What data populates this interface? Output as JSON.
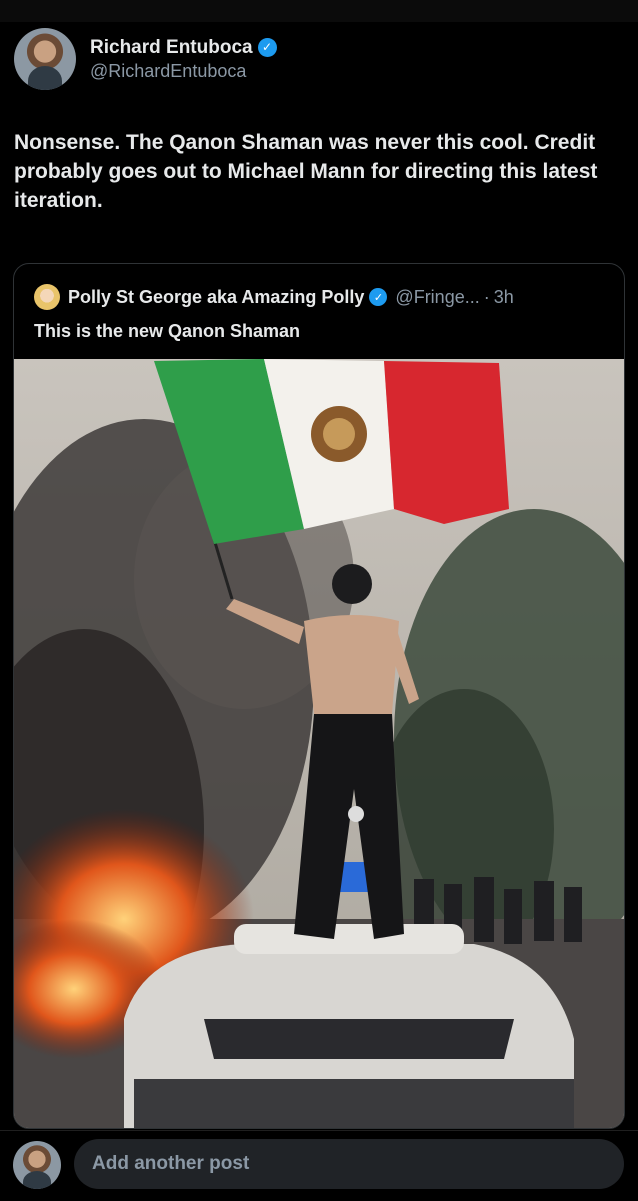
{
  "post": {
    "author": {
      "display_name": "Richard Entuboca",
      "handle": "@RichardEntuboca",
      "verified_icon": "verified-badge-icon"
    },
    "text": "Nonsense. The Qanon Shaman was never this cool. Credit probably goes out to Michael Mann for directing this latest iteration."
  },
  "quote": {
    "author": {
      "display_name": "Polly St George aka Amazing Polly",
      "handle": "@Fringe...",
      "time": "3h",
      "separator": "·",
      "verified_icon": "verified-badge-icon"
    },
    "text": "This is the new Qanon Shaman",
    "media_type": "photo"
  },
  "reply": {
    "placeholder": "Add another post"
  },
  "colors": {
    "background": "#000000",
    "text": "#e7e9ea",
    "muted": "#8b98a5",
    "verified": "#1d9bf0",
    "input_bg": "#202327"
  }
}
